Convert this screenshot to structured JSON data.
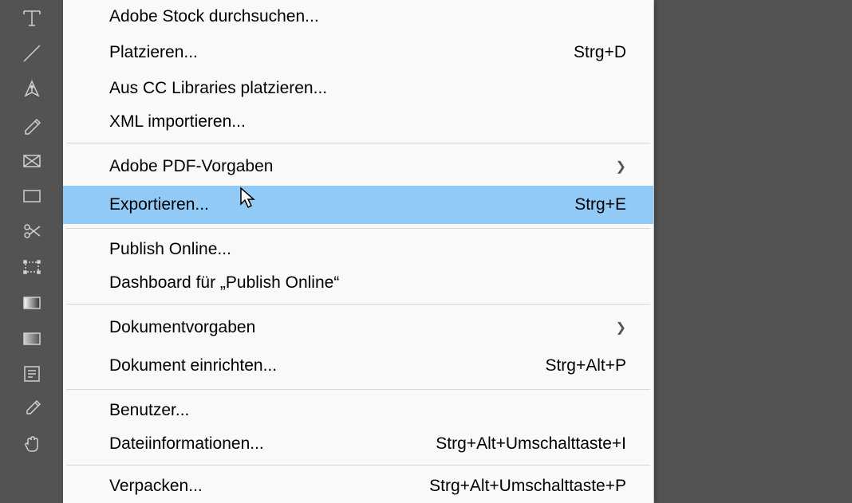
{
  "menu": {
    "items": [
      {
        "label": "Adobe Stock durchsuchen...",
        "shortcut": "",
        "submenu": false,
        "highlighted": false
      },
      {
        "label": "Platzieren...",
        "shortcut": "Strg+D",
        "submenu": false,
        "highlighted": false
      },
      {
        "label": "Aus CC Libraries platzieren...",
        "shortcut": "",
        "submenu": false,
        "highlighted": false
      },
      {
        "label": "XML importieren...",
        "shortcut": "",
        "submenu": false,
        "highlighted": false
      },
      {
        "sep": true
      },
      {
        "label": "Adobe PDF-Vorgaben",
        "shortcut": "",
        "submenu": true,
        "highlighted": false
      },
      {
        "label": "Exportieren...",
        "shortcut": "Strg+E",
        "submenu": false,
        "highlighted": true
      },
      {
        "sep": true
      },
      {
        "label": "Publish Online...",
        "shortcut": "",
        "submenu": false,
        "highlighted": false
      },
      {
        "label": "Dashboard für „Publish Online“",
        "shortcut": "",
        "submenu": false,
        "highlighted": false
      },
      {
        "sep": true
      },
      {
        "label": "Dokumentvorgaben",
        "shortcut": "",
        "submenu": true,
        "highlighted": false
      },
      {
        "label": "Dokument einrichten...",
        "shortcut": "Strg+Alt+P",
        "submenu": false,
        "highlighted": false
      },
      {
        "sep": true
      },
      {
        "label": "Benutzer...",
        "shortcut": "",
        "submenu": false,
        "highlighted": false
      },
      {
        "label": "Dateiinformationen...",
        "shortcut": "Strg+Alt+Umschalttaste+I",
        "submenu": false,
        "highlighted": false
      },
      {
        "sep": true
      },
      {
        "label": "Verpacken...",
        "shortcut": "Strg+Alt+Umschalttaste+P",
        "submenu": false,
        "highlighted": false
      }
    ]
  },
  "tools": [
    "type-tool",
    "line-tool",
    "pen-tool",
    "pencil-tool",
    "rectangle-frame-tool",
    "rectangle-tool",
    "scissors-tool",
    "free-transform-tool",
    "gradient-swatch-tool",
    "gradient-feather-tool",
    "note-tool",
    "eyedropper-tool",
    "hand-tool"
  ]
}
